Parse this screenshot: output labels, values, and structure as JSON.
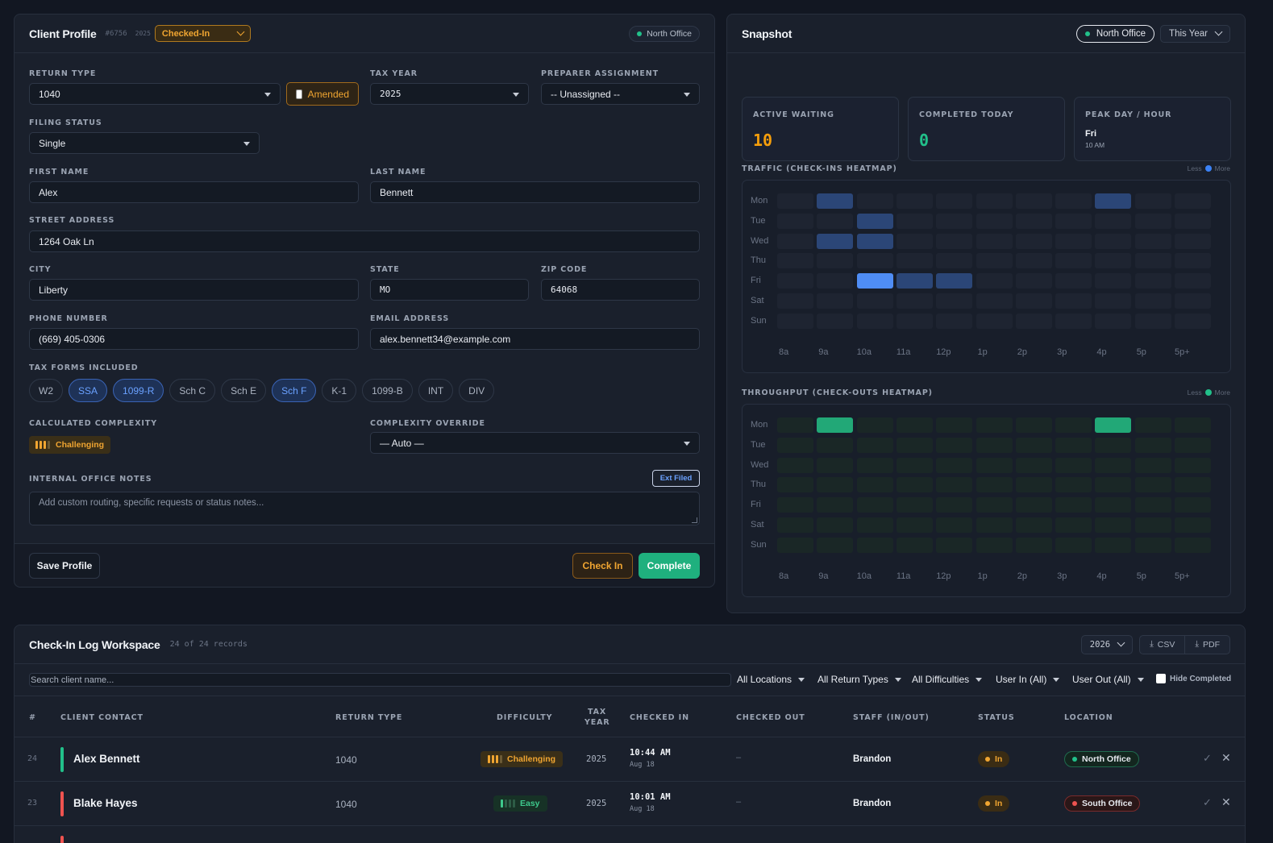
{
  "profile": {
    "title": "Client Profile",
    "client_id": "#6756",
    "year": "2025",
    "status_select": "Checked-In",
    "office_badge": "North Office",
    "return_type_label": "RETURN TYPE",
    "return_type": "1040",
    "amended_label": "Amended",
    "tax_year_label": "TAX YEAR",
    "tax_year": "2025",
    "preparer_label": "PREPARER ASSIGNMENT",
    "preparer": "-- Unassigned --",
    "filing_status_label": "FILING STATUS",
    "filing_status": "Single",
    "first_name_label": "FIRST NAME",
    "first_name": "Alex",
    "last_name_label": "LAST NAME",
    "last_name": "Bennett",
    "street_label": "STREET ADDRESS",
    "street": "1264 Oak Ln",
    "city_label": "CITY",
    "city": "Liberty",
    "state_label": "STATE",
    "state": "MO",
    "zip_label": "ZIP CODE",
    "zip": "64068",
    "phone_label": "PHONE NUMBER",
    "phone": "(669) 405-0306",
    "email_label": "EMAIL ADDRESS",
    "email": "alex.bennett34@example.com",
    "forms_label": "TAX FORMS INCLUDED",
    "forms": [
      {
        "label": "W2",
        "selected": false
      },
      {
        "label": "SSA",
        "selected": true
      },
      {
        "label": "1099-R",
        "selected": true
      },
      {
        "label": "Sch C",
        "selected": false
      },
      {
        "label": "Sch E",
        "selected": false
      },
      {
        "label": "Sch F",
        "selected": true
      },
      {
        "label": "K-1",
        "selected": false
      },
      {
        "label": "1099-B",
        "selected": false
      },
      {
        "label": "INT",
        "selected": false
      },
      {
        "label": "DIV",
        "selected": false
      }
    ],
    "complexity_label": "CALCULATED COMPLEXITY",
    "complexity": "Challenging",
    "override_label": "COMPLEXITY OVERRIDE",
    "override": "— Auto —",
    "notes_label": "INTERNAL OFFICE NOTES",
    "ext_filed": "Ext Filed",
    "notes_placeholder": "Add custom routing, specific requests or status notes...",
    "save_label": "Save Profile",
    "checkin_label": "Check In",
    "complete_label": "Complete"
  },
  "snapshot": {
    "title": "Snapshot",
    "office_filter": "North Office",
    "period_filter": "This Year",
    "stats": [
      {
        "title": "ACTIVE WAITING",
        "value": "10",
        "color": "#f59e0b"
      },
      {
        "title": "COMPLETED TODAY",
        "value": "0",
        "color": "#22c08a"
      },
      {
        "title": "PEAK DAY / HOUR",
        "value": "Fri",
        "sub": "10 AM"
      }
    ],
    "traffic_title": "TRAFFIC (CHECK-INS HEATMAP)",
    "throughput_title": "THROUGHPUT (CHECK-OUTS HEATMAP)",
    "legend_less": "Less",
    "legend_more": "More",
    "days": [
      "Mon",
      "Tue",
      "Wed",
      "Thu",
      "Fri",
      "Sat",
      "Sun"
    ],
    "hours": [
      "8a",
      "9a",
      "10a",
      "11a",
      "12p",
      "1p",
      "2p",
      "3p",
      "4p",
      "5p",
      "5p+"
    ],
    "traffic": [
      [
        0,
        1,
        0,
        0,
        0,
        0,
        0,
        0,
        1,
        0,
        0
      ],
      [
        0,
        0,
        1,
        0,
        0,
        0,
        0,
        0,
        0,
        0,
        0
      ],
      [
        0,
        1,
        1,
        0,
        0,
        0,
        0,
        0,
        0,
        0,
        0
      ],
      [
        0,
        0,
        0,
        0,
        0,
        0,
        0,
        0,
        0,
        0,
        0
      ],
      [
        0,
        0,
        2,
        1,
        1,
        0,
        0,
        0,
        0,
        0,
        0
      ],
      [
        0,
        0,
        0,
        0,
        0,
        0,
        0,
        0,
        0,
        0,
        0
      ],
      [
        0,
        0,
        0,
        0,
        0,
        0,
        0,
        0,
        0,
        0,
        0
      ]
    ],
    "throughput": [
      [
        0,
        1,
        0,
        0,
        0,
        0,
        0,
        0,
        1,
        0,
        0
      ],
      [
        0,
        0,
        0,
        0,
        0,
        0,
        0,
        0,
        0,
        0,
        0
      ],
      [
        0,
        0,
        0,
        0,
        0,
        0,
        0,
        0,
        0,
        0,
        0
      ],
      [
        0,
        0,
        0,
        0,
        0,
        0,
        0,
        0,
        0,
        0,
        0
      ],
      [
        0,
        0,
        0,
        0,
        0,
        0,
        0,
        0,
        0,
        0,
        0
      ],
      [
        0,
        0,
        0,
        0,
        0,
        0,
        0,
        0,
        0,
        0,
        0
      ],
      [
        0,
        0,
        0,
        0,
        0,
        0,
        0,
        0,
        0,
        0,
        0
      ]
    ]
  },
  "log": {
    "title": "Check-In Log Workspace",
    "count": "24 of 24 records",
    "year": "2026",
    "csv": "CSV",
    "pdf": "PDF",
    "search_placeholder": "Search client name...",
    "filters": [
      "All Locations",
      "All Return Types",
      "All Difficulties",
      "User In (All)",
      "User Out (All)"
    ],
    "hide_completed": "Hide Completed",
    "headers": {
      "num": "#",
      "client": "CLIENT CONTACT",
      "return_type": "RETURN TYPE",
      "difficulty": "DIFFICULTY",
      "tax_year_1": "TAX",
      "tax_year_2": "YEAR",
      "checked_in": "CHECKED IN",
      "checked_out": "CHECKED OUT",
      "staff": "STAFF (IN/OUT)",
      "status": "STATUS",
      "location": "LOCATION"
    },
    "rows": [
      {
        "num": "24",
        "name": "Alex Bennett",
        "accent": "#22c08a",
        "return_type": "1040",
        "difficulty": "Challenging",
        "tax_year": "2025",
        "in_time": "10:44 AM",
        "in_date": "Aug 18",
        "out": "–",
        "staff": "Brandon",
        "status": "In",
        "location": "North Office",
        "location_color": "#22c08a"
      },
      {
        "num": "23",
        "name": "Blake Hayes",
        "accent": "#ef5350",
        "return_type": "1040",
        "difficulty": "Easy",
        "tax_year": "2025",
        "in_time": "10:01 AM",
        "in_date": "Aug 18",
        "out": "–",
        "staff": "Brandon",
        "status": "In",
        "location": "South Office",
        "location_color": "#ef5350"
      }
    ]
  }
}
